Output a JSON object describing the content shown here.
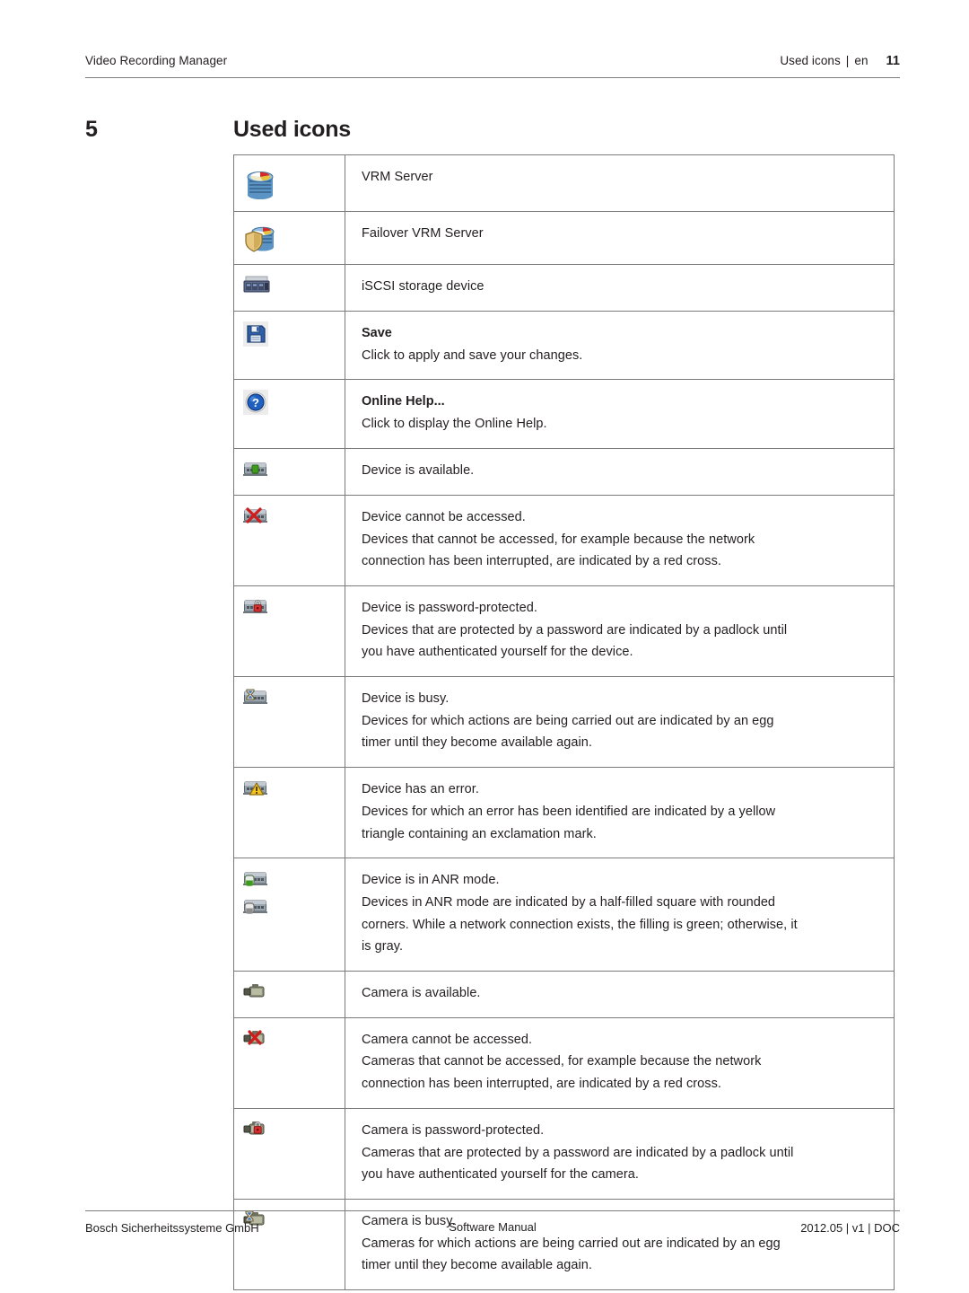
{
  "header": {
    "left_title": "Video Recording Manager",
    "section": "Used icons",
    "separator": "|",
    "language": "en",
    "page_number": "11"
  },
  "title": {
    "chapter_number": "5",
    "chapter_title": "Used icons"
  },
  "table": {
    "rows": [
      {
        "icon": "vrm-server-icon",
        "icons": [
          "vrm-server-icon"
        ],
        "term": "",
        "lines": [
          "VRM Server"
        ]
      },
      {
        "icon": "failover-vrm-server-icon",
        "icons": [
          "failover-vrm-server-icon"
        ],
        "term": "",
        "lines": [
          "Failover VRM Server"
        ]
      },
      {
        "icon": "iscsi-storage-device-icon",
        "icons": [
          "iscsi-storage-device-icon"
        ],
        "term": "",
        "lines": [
          "iSCSI storage device"
        ]
      },
      {
        "icon": "save-floppy-icon",
        "icons": [
          "save-floppy-icon"
        ],
        "term": "Save",
        "lines": [
          "Click to apply and save your changes."
        ]
      },
      {
        "icon": "online-help-question-icon",
        "icons": [
          "online-help-question-icon"
        ],
        "term": "Online Help...",
        "lines": [
          "Click to display the Online Help."
        ]
      },
      {
        "icon": "device-available-icon",
        "icons": [
          "device-available-icon"
        ],
        "term": "",
        "lines": [
          "Device is available."
        ]
      },
      {
        "icon": "device-not-accessible-icon",
        "icons": [
          "device-not-accessible-icon"
        ],
        "term": "",
        "lines": [
          "Device cannot be accessed.",
          "Devices that cannot be accessed, for example because the network",
          "connection has been interrupted, are indicated by a red cross."
        ]
      },
      {
        "icon": "device-password-protected-icon",
        "icons": [
          "device-password-protected-icon"
        ],
        "term": "",
        "lines": [
          "Device is password-protected.",
          "Devices that are protected by a password are indicated by a padlock until",
          "you have authenticated yourself for the device."
        ]
      },
      {
        "icon": "device-busy-icon",
        "icons": [
          "device-busy-icon"
        ],
        "term": "",
        "lines": [
          "Device is busy.",
          "Devices for which actions are being carried out are indicated by an egg",
          "timer until they become available again."
        ]
      },
      {
        "icon": "device-error-icon",
        "icons": [
          "device-error-icon"
        ],
        "term": "",
        "lines": [
          "Device has an error.",
          "Devices for which an error has been identified are indicated by a yellow",
          "triangle containing an exclamation mark."
        ]
      },
      {
        "icon": "device-anr-green-icon",
        "icons": [
          "device-anr-green-icon",
          "device-anr-gray-icon"
        ],
        "term": "",
        "lines": [
          "Device is in ANR mode.",
          "Devices in ANR mode are indicated by a half-filled square with rounded",
          "corners. While a network connection exists, the filling is green; otherwise, it",
          "is gray."
        ]
      },
      {
        "icon": "camera-available-icon",
        "icons": [
          "camera-available-icon"
        ],
        "term": "",
        "lines": [
          "Camera is available."
        ]
      },
      {
        "icon": "camera-not-accessible-icon",
        "icons": [
          "camera-not-accessible-icon"
        ],
        "term": "",
        "lines": [
          "Camera cannot be accessed.",
          "Cameras that cannot be accessed, for example because the network",
          "connection has been interrupted, are indicated by a red cross."
        ]
      },
      {
        "icon": "camera-password-protected-icon",
        "icons": [
          "camera-password-protected-icon"
        ],
        "term": "",
        "lines": [
          "Camera is password-protected.",
          "Cameras that are protected by a password are indicated by a padlock until",
          "you have authenticated yourself for the camera."
        ]
      },
      {
        "icon": "camera-busy-icon",
        "icons": [
          "camera-busy-icon"
        ],
        "term": "",
        "lines": [
          "Camera is busy.",
          "Cameras for which actions are being carried out are indicated by an egg",
          "timer until they become available again."
        ]
      }
    ]
  },
  "footer": {
    "left": "Bosch Sicherheitssysteme GmbH",
    "center": "Software Manual",
    "right": "2012.05 | v1 | DOC"
  },
  "colors": {
    "rule": "#7d7d7d",
    "table_border": "#7a7a7a",
    "text": "#231f20",
    "icon_blue": "#2e6da4",
    "icon_green": "#3f9b1e",
    "icon_red": "#d02020",
    "icon_yellow": "#f4c41a"
  }
}
